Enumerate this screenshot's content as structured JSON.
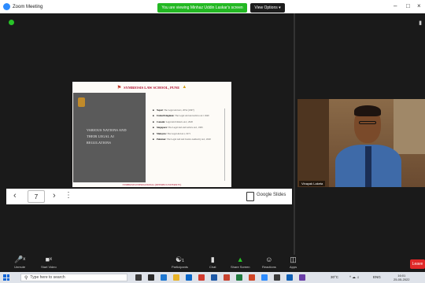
{
  "titlebar": {
    "title": "Zoom Meeting",
    "share_notice": "You are viewing Minhaz Uddin Laskar's screen",
    "view_options": "View Options ▾",
    "minimize": "–",
    "maximize": "□",
    "close": "×"
  },
  "slide": {
    "header": "SYMBIOSIS LAW SCHOOL, PUNE",
    "heading_lines": [
      "VARIOUS NATIONS AND",
      "THEIR LEGAL AI",
      "REGULATIONS"
    ],
    "bullets": [
      {
        "country": "Nepal:",
        "text": "The Legal Aid Act, 2054 (1997)"
      },
      {
        "country": "United Kingdom:",
        "text": "The Legal Aid and Advice Act 1949"
      },
      {
        "country": "Canada:",
        "text": "Legal Aid Ontario Act, 2020"
      },
      {
        "country": "Singapore:",
        "text": "The Legal Aid and Advice Act, 1995"
      },
      {
        "country": "Malaysia:",
        "text": "The Legal Aid Act, 1971"
      },
      {
        "country": "Pakistan:",
        "text": "The Legal Aid and Justice Authority Act, 2020"
      }
    ],
    "footer": "SYMBIOSIS INTERNATIONAL (DEEMED UNIVERSITY)"
  },
  "slides_bar": {
    "prev": "‹",
    "page": "7",
    "next": "›",
    "more": "⋮",
    "app_label": "Google Slides"
  },
  "video": {
    "participant_name": "Vinayak Laketa"
  },
  "toolbar": {
    "items": [
      {
        "label": "Unmute",
        "icon": "microphone-icon"
      },
      {
        "label": "Start Video",
        "icon": "video-camera-icon"
      },
      {
        "label": "Participants",
        "icon": "participants-icon",
        "count": "1"
      },
      {
        "label": "Chat",
        "icon": "chat-icon"
      },
      {
        "label": "Share Screen",
        "icon": "share-screen-icon"
      },
      {
        "label": "Reactions",
        "icon": "reactions-icon"
      },
      {
        "label": "Apps",
        "icon": "apps-icon"
      }
    ],
    "end_label": "Leave"
  },
  "taskbar": {
    "search_placeholder": "Type here to search",
    "temperature": "30°C",
    "language": "ENG",
    "time": "16:01",
    "date": "25-05-2022"
  },
  "colors": {
    "share_green": "#23b823",
    "leave_red": "#e02828",
    "slide_accent": "#b01030"
  }
}
